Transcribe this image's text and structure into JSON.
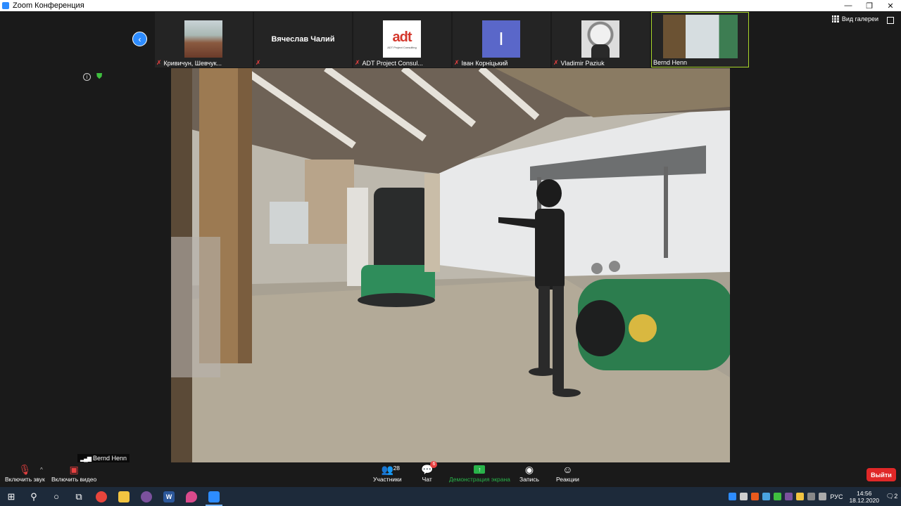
{
  "window": {
    "title": "Zoom Конференция",
    "minimize": "—",
    "restore": "❐",
    "close": "✕"
  },
  "view_mode": "Вид галереи",
  "participants": [
    {
      "name": "Кривичун, Шевчук...",
      "muted": true,
      "kind": "photo"
    },
    {
      "name": "",
      "center_name": "Вячеслав Чалий",
      "muted": true,
      "kind": "text"
    },
    {
      "name": "ADT Project Consul...",
      "muted": true,
      "kind": "logo"
    },
    {
      "name": "Іван Корніцький",
      "muted": true,
      "kind": "letter",
      "letter": "I"
    },
    {
      "name": "Vladimir Paziuk",
      "muted": true,
      "kind": "photo-bw"
    },
    {
      "name": "Bernd Henn",
      "muted": false,
      "kind": "video",
      "active": true
    }
  ],
  "adt_logo": {
    "text": "adt",
    "sub": "ADT Project Consulting"
  },
  "active_speaker": {
    "name": "Bernd Henn"
  },
  "toolbar": {
    "mute_label": "Включить звук",
    "video_label": "Включить видео",
    "participants_label": "Участники",
    "participants_count": "28",
    "chat_label": "Чат",
    "chat_badge": "6",
    "share_label": "Демонстрация экрана",
    "record_label": "Запись",
    "reactions_label": "Реакции",
    "leave_label": "Выйти"
  },
  "taskbar": {
    "lang": "РУС",
    "time": "14:56",
    "date": "18.12.2020",
    "notifications": "2"
  },
  "colors": {
    "accent": "#2d8cff",
    "danger": "#e02828",
    "share": "#29b34a",
    "active_border": "#a8d52a"
  }
}
